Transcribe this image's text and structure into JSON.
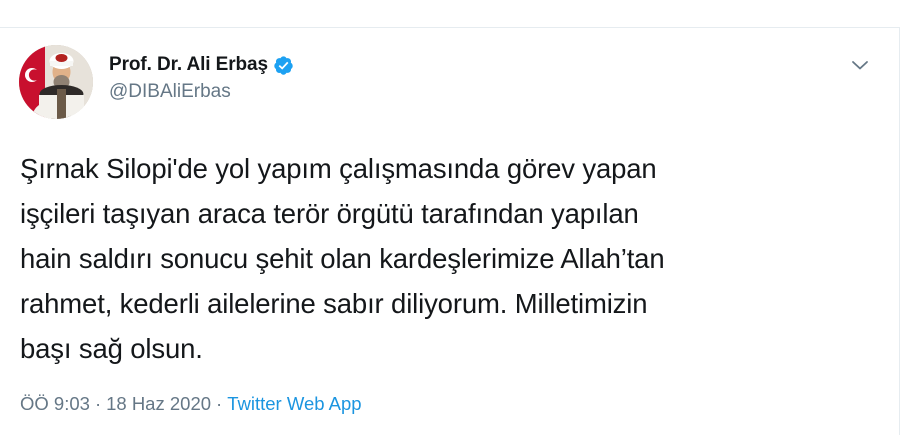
{
  "author": {
    "display_name": "Prof. Dr. Ali Erbaş",
    "handle": "@DIBAliErbas",
    "verified": true,
    "avatar": "profile-photo"
  },
  "tweet": {
    "text": "Şırnak Silopi'de yol yapım çalışmasında görev yapan\nişçileri taşıyan araca terör örgütü tarafından yapılan\nhain saldırı sonucu şehit olan kardeşlerimize Allah’tan\nrahmet, kederli ailelerine sabır diliyorum. Milletimizin\nbaşı sağ olsun.",
    "time": "ÖÖ 9:03",
    "date": "18 Haz 2020",
    "separator": "·",
    "source": "Twitter Web App"
  },
  "icons": {
    "verified": "verified-badge-icon",
    "menu": "chevron-down-icon"
  },
  "colors": {
    "accent": "#1da1f2",
    "link": "#1b95e0",
    "secondary_text": "#657786",
    "primary_text": "#14171a",
    "divider": "#e6ecf0"
  }
}
